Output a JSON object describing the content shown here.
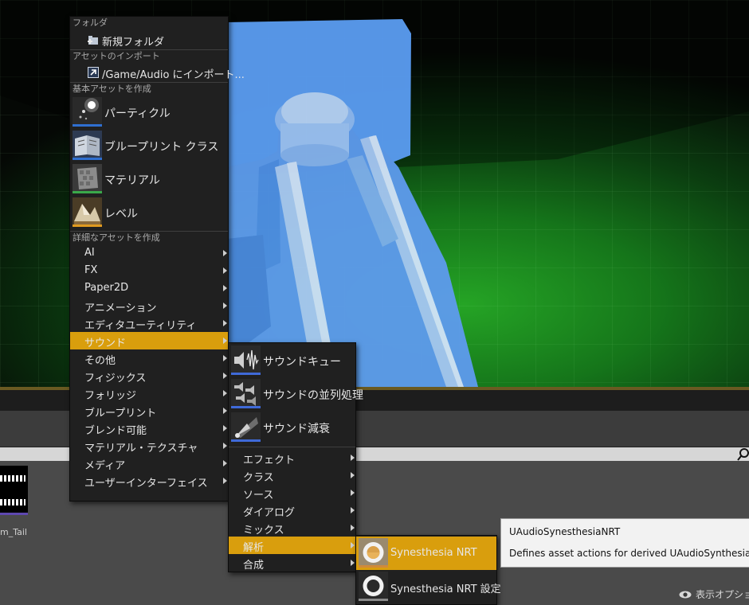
{
  "menu": {
    "sections": {
      "folder": "フォルダ",
      "import": "アセットのインポート",
      "basic": "基本アセットを作成",
      "advanced": "詳細なアセットを作成"
    },
    "new_folder": "新規フォルダ",
    "import_path": "/Game/Audio にインポート...",
    "basic_items": [
      "パーティクル",
      "ブループリント クラス",
      "マテリアル",
      "レベル"
    ],
    "advanced_items": [
      "AI",
      "FX",
      "Paper2D",
      "アニメーション",
      "エディタユーティリティ",
      "サウンド",
      "その他",
      "フィジックス",
      "フォリッジ",
      "ブループリント",
      "ブレンド可能",
      "マテリアル・テクスチャ",
      "メディア",
      "ユーザーインターフェイス"
    ]
  },
  "sound_menu": {
    "big_items": [
      "サウンドキュー",
      "サウンドの並列処理",
      "サウンド減衰"
    ],
    "items": [
      "エフェクト",
      "クラス",
      "ソース",
      "ダイアログ",
      "ミックス",
      "解析",
      "合成"
    ]
  },
  "analysis_menu": {
    "items": [
      "Synesthesia NRT",
      "Synesthesia NRT 設定"
    ]
  },
  "tooltip": {
    "title": "UAudioSynesthesiaNRT",
    "description": "Defines asset actions for derived UAudioSynthesiaNRT s"
  },
  "content_browser": {
    "asset_label": "m_Tail",
    "view_options": "表示オプション"
  },
  "colors": {
    "highlight": "#d99e0d",
    "particle_bar": "#2f6fd0",
    "blueprint_bar": "#2f6fd0",
    "material_bar": "#3aa84a",
    "level_bar": "#e09a20",
    "sound_bar": "#3f6ad8",
    "synesthesia_bar": "#d08a3a"
  }
}
